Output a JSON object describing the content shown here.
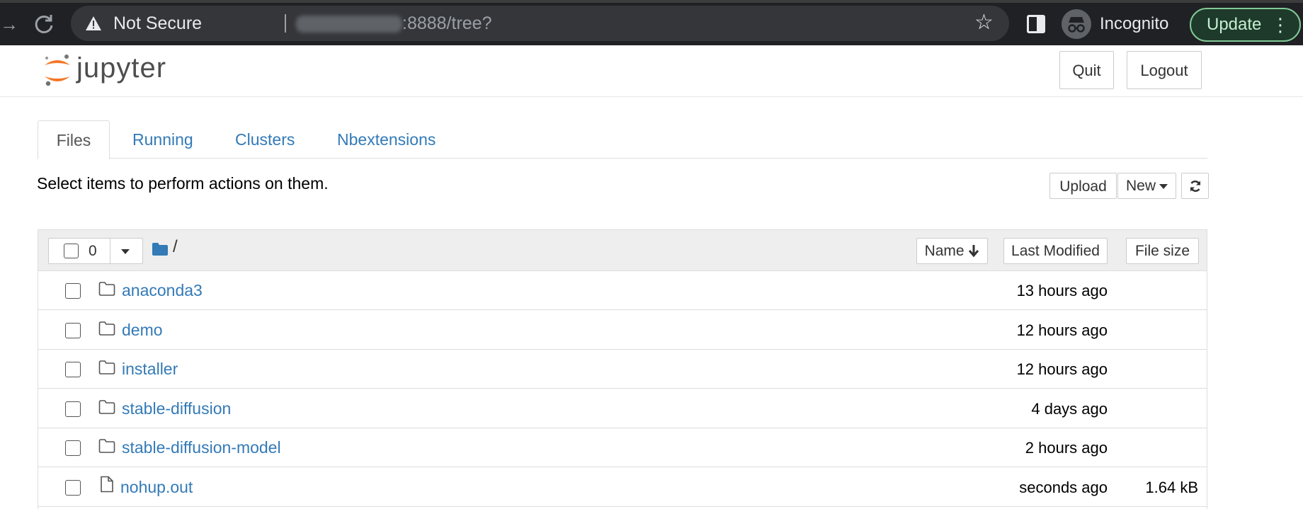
{
  "browser": {
    "security_label": "Not Secure",
    "url_suffix": ":8888/tree?",
    "profile_label": "Incognito",
    "update_label": "Update",
    "icons": [
      "forward-icon",
      "reload-icon",
      "warning-icon",
      "star-icon",
      "side-panel-icon",
      "incognito-icon",
      "kebab-menu-icon"
    ]
  },
  "header": {
    "logo_text": "jupyter",
    "quit_label": "Quit",
    "logout_label": "Logout"
  },
  "tabs": [
    {
      "label": "Files",
      "active": true
    },
    {
      "label": "Running",
      "active": false
    },
    {
      "label": "Clusters",
      "active": false
    },
    {
      "label": "Nbextensions",
      "active": false
    }
  ],
  "toolbar": {
    "hint": "Select items to perform actions on them.",
    "upload_label": "Upload",
    "new_label": "New"
  },
  "list": {
    "selected_count": "0",
    "path": "/",
    "columns": {
      "name": "Name",
      "last_modified": "Last Modified",
      "file_size": "File size"
    },
    "items": [
      {
        "name": "anaconda3",
        "type": "folder",
        "modified": "13 hours ago",
        "size": ""
      },
      {
        "name": "demo",
        "type": "folder",
        "modified": "12 hours ago",
        "size": ""
      },
      {
        "name": "installer",
        "type": "folder",
        "modified": "12 hours ago",
        "size": ""
      },
      {
        "name": "stable-diffusion",
        "type": "folder",
        "modified": "4 days ago",
        "size": ""
      },
      {
        "name": "stable-diffusion-model",
        "type": "folder",
        "modified": "2 hours ago",
        "size": ""
      },
      {
        "name": "nohup.out",
        "type": "file",
        "modified": "seconds ago",
        "size": "1.64 kB"
      }
    ]
  },
  "colors": {
    "link": "#337ab7",
    "chrome_bg": "#202124",
    "update_border": "#81c995",
    "logo_orange": "#f37726"
  }
}
